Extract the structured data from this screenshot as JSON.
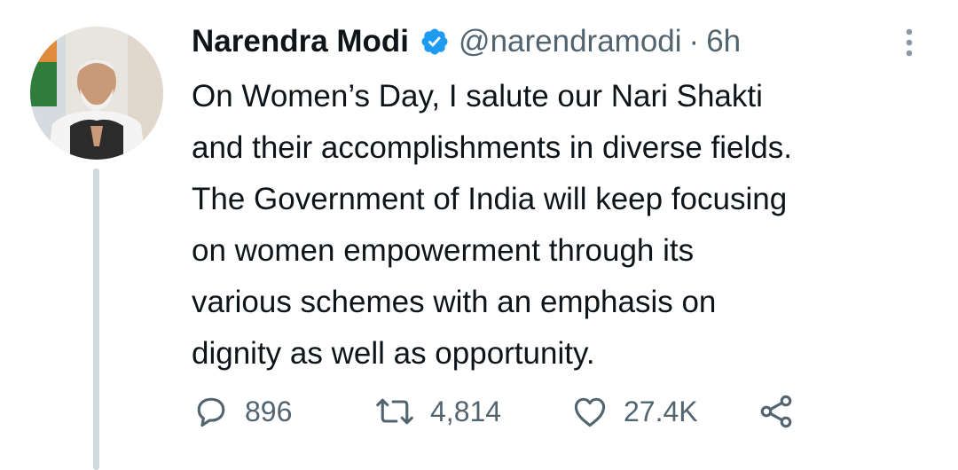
{
  "tweet": {
    "author": {
      "display_name": "Narendra Modi",
      "handle": "@narendramodi",
      "verified": true
    },
    "separator": "·",
    "time": "6h",
    "text": "On Women’s Day, I salute our Nari Shakti\nand their accomplishments in diverse fields.\nThe Government of India will keep focusing\non women empowerment through its\nvarious schemes with an emphasis on\ndignity as well as opportunity.",
    "actions": {
      "replies": "896",
      "retweets": "4,814",
      "likes": "27.4K"
    }
  },
  "icons": {
    "verified": "verified-badge-icon",
    "more": "more-vertical-icon",
    "reply": "reply-icon",
    "retweet": "retweet-icon",
    "like": "heart-icon",
    "share": "share-icon"
  },
  "colors": {
    "verified_blue": "#1d9bf0",
    "secondary_text": "#536471",
    "primary_text": "#0f1419",
    "thread_line": "#cfd9de"
  }
}
